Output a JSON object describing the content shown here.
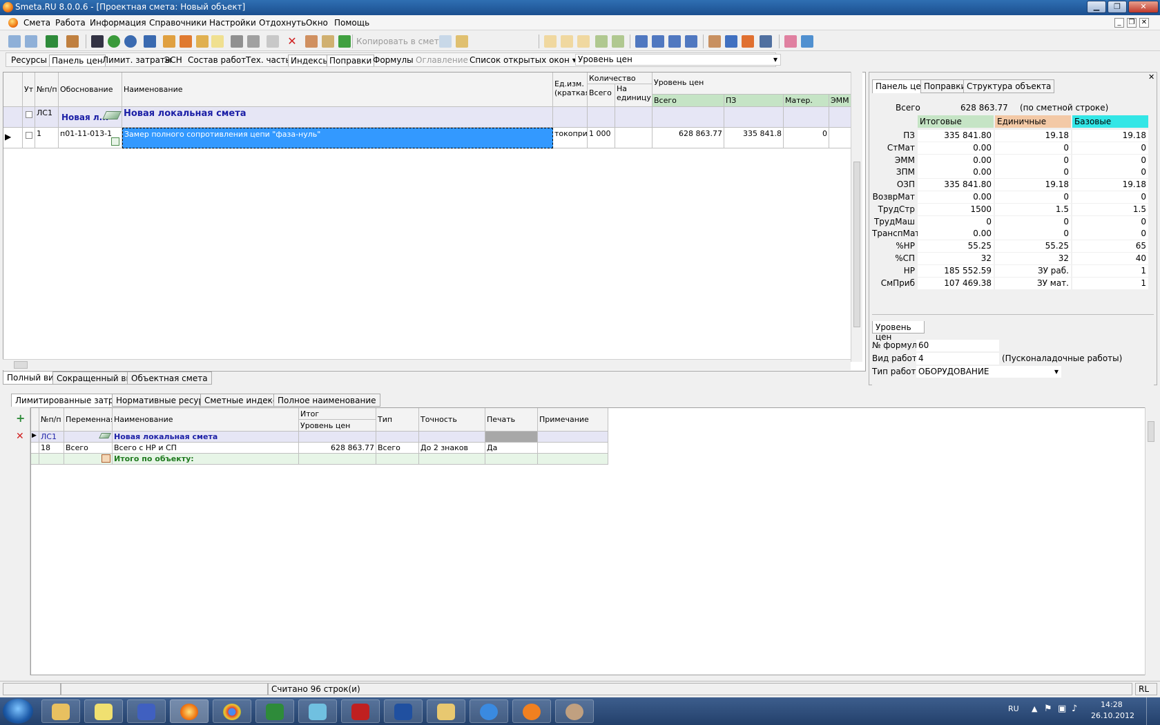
{
  "window": {
    "title": "Smeta.RU  8.0.0.6  - [Проектная смета: Новый объект]"
  },
  "menu": [
    "Смета",
    "Работа",
    "Информация",
    "Справочники",
    "Настройки",
    "Отдохнуть",
    "Окно",
    "Помощь"
  ],
  "toolbar": {
    "copy_label": "Копировать в смету"
  },
  "tabs1": [
    "Ресурсы",
    "Панель цен",
    "Лимит. затраты",
    "ЭСН",
    "Состав работ",
    "Тех. часть",
    "Индексы",
    "Поправки",
    "Формулы",
    "Оглавление",
    "Список открытых окон"
  ],
  "price_level_combo": "Уровень цен",
  "grid1": {
    "headers": {
      "ut": "Ут",
      "num": "№п/п",
      "basis": "Обоснование",
      "name": "Наименование",
      "unit": "Ед.изм. (краткая)",
      "qty": "Количество",
      "qty_total": "Всего",
      "qty_per": "На единицу",
      "price": "Уровень цен",
      "p_total": "Всего",
      "p_pz": "ПЗ",
      "p_mat": "Матер.",
      "p_emm": "ЭММ"
    },
    "section": {
      "num": "ЛС1",
      "basis": "Новая л...",
      "name": "Новая локальная смета"
    },
    "row": {
      "num": "1",
      "basis": "п01-11-013-1",
      "name": "Замер полного сопротивления цепи \"фаза-нуль\"",
      "unit": "токоприе",
      "qty_total": "1 000",
      "p_total": "628 863.77",
      "p_pz": "335 841.8",
      "p_mat": "0"
    }
  },
  "tabs2": [
    "Полный вид",
    "Сокращенный вид",
    "Объектная смета"
  ],
  "rpanel": {
    "tabs": [
      "Панель цен",
      "Поправки",
      "Структура объекта"
    ],
    "total_label": "Всего",
    "total_value": "628 863.77",
    "total_note": "(по сметной строке)",
    "col_headers": [
      "Итоговые",
      "Единичные",
      "Базовые"
    ],
    "rows": [
      {
        "label": "ПЗ",
        "v1": "335 841.80",
        "v2": "19.18",
        "v3": "19.18"
      },
      {
        "label": "СтМат",
        "v1": "0.00",
        "v2": "0",
        "v3": "0"
      },
      {
        "label": "ЭММ",
        "v1": "0.00",
        "v2": "0",
        "v3": "0"
      },
      {
        "label": "ЗПМ",
        "v1": "0.00",
        "v2": "0",
        "v3": "0"
      },
      {
        "label": "ОЗП",
        "v1": "335 841.80",
        "v2": "19.18",
        "v3": "19.18"
      },
      {
        "label": "ВозврМат",
        "v1": "0.00",
        "v2": "0",
        "v3": "0"
      },
      {
        "label": "ТрудСтр",
        "v1": "1500",
        "v2": "1.5",
        "v3": "1.5"
      },
      {
        "label": "ТрудМаш",
        "v1": "0",
        "v2": "0",
        "v3": "0"
      },
      {
        "label": "ТранспМат",
        "v1": "0.00",
        "v2": "0",
        "v3": "0"
      },
      {
        "label": "%НР",
        "v1": "55.25",
        "v2": "55.25",
        "v3": "65"
      },
      {
        "label": "%СП",
        "v1": "32",
        "v2": "32",
        "v3": "40"
      },
      {
        "label": "НР",
        "v1": "185 552.59",
        "v2": "ЗУ раб.",
        "v3": "1"
      },
      {
        "label": "СмПриб",
        "v1": "107 469.38",
        "v2": "ЗУ мат.",
        "v3": "1"
      }
    ],
    "bottom_tab": "Уровень цен",
    "formula_label": "№ формулы",
    "formula_value": "60",
    "worktype_label": "Вид работы",
    "worktype_value": "4",
    "worktype_note": "(Пусконаладочные работы)",
    "worktype2_label": "Тип работы",
    "worktype2_value": "ОБОРУДОВАНИЕ"
  },
  "tabs3": [
    "Лимитированные затраты",
    "Нормативные ресурсы",
    "Сметные индексы",
    "Полное наименование"
  ],
  "grid2": {
    "headers": {
      "num": "№п/п",
      "var": "Переменная",
      "name": "Наименование",
      "itog": "Итог",
      "level": "Уровень цен",
      "type": "Тип",
      "prec": "Точность",
      "print": "Печать",
      "note": "Примечание"
    },
    "section": {
      "num": "ЛС1",
      "name": "Новая локальная смета"
    },
    "row": {
      "num": "18",
      "var": "Всего",
      "name": "Всего с НР и СП",
      "level": "628 863.77",
      "type": "Всего",
      "prec": "До 2 знаков",
      "print": "Да"
    },
    "total": {
      "name": "Итого по объекту:"
    }
  },
  "status": {
    "text": "Считано 96 строк(и)",
    "lang": "RL"
  },
  "tray": {
    "lang": "RU",
    "time": "14:28",
    "date": "26.10.2012"
  },
  "colors": {
    "title_bar": "#1b4f8f",
    "selection": "#3399ff",
    "header_green": "#c5e4c5",
    "rp_itog": "#c5e4c5",
    "rp_ed": "#f3c9a6",
    "rp_base": "#33e6e6"
  }
}
